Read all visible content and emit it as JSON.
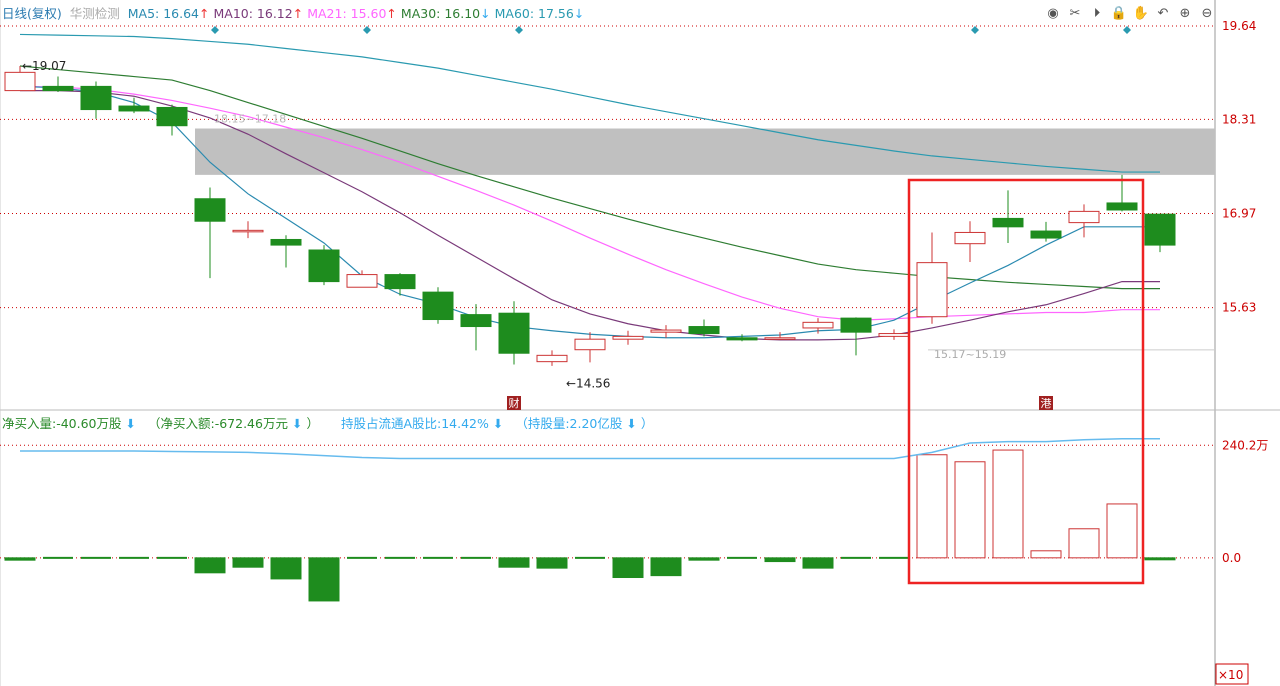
{
  "header": {
    "period": "日线(复权)",
    "name": "华测检测",
    "ma": [
      {
        "label": "MA5: ",
        "value": "16.64",
        "arrow": "↑",
        "color": "#2a8ab0"
      },
      {
        "label": "MA10: ",
        "value": "16.12",
        "arrow": "↑",
        "color": "#7a3a7a"
      },
      {
        "label": "MA21: ",
        "value": "15.60",
        "arrow": "↑",
        "color": "#ff66ff"
      },
      {
        "label": "MA30: ",
        "value": "16.10",
        "arrow": "↓",
        "color": "#2e7d32"
      },
      {
        "label": "MA60: ",
        "value": "17.56",
        "arrow": "↓",
        "color": "#2a9ab0"
      }
    ]
  },
  "toolbar": {
    "icons": [
      "eye-icon",
      "scissors-icon",
      "play-icon",
      "lock-icon",
      "hand-icon",
      "undo-icon",
      "zoom-in-icon",
      "zoom-out-icon"
    ],
    "glyphs": [
      "◉",
      "✂",
      "⏵",
      "🔒",
      "✋",
      "↶",
      "⊕",
      "⊖"
    ]
  },
  "indicator": {
    "net_buy": "净买入量:-40.60万股",
    "net_amount": "（净买入额:-672.46万元",
    "holding_ratio": "持股占流通A股比:14.42%",
    "holding_qty": "（持股量:2.20亿股",
    "arrow_down": "⬇",
    "close_paren": "）"
  },
  "markers": {
    "cai": "财",
    "gang": "港"
  },
  "colors": {
    "up": "#cc3333",
    "down": "#1e8c1e",
    "ma5": "#2a8ab0",
    "ma10": "#7a3a7a",
    "ma21": "#ff66ff",
    "ma30": "#2e7d32",
    "ma60": "#2a9ab0",
    "hold": "#66bbee",
    "grid": "#cc0000",
    "highlight": "#ee2222"
  },
  "chart_data": {
    "type": "candlestick",
    "y_ticks": [
      19.64,
      18.31,
      16.97,
      15.63
    ],
    "ylim": [
      14.2,
      19.64
    ],
    "annotations": {
      "high": "19.07",
      "low": "14.56",
      "gap_upper": "18.15~17.18",
      "gap_lower": "15.17~15.19"
    },
    "candles": [
      {
        "o": 18.72,
        "c": 18.98,
        "h": 19.07,
        "l": 18.72
      },
      {
        "o": 18.78,
        "c": 18.72,
        "h": 18.92,
        "l": 18.7
      },
      {
        "o": 18.78,
        "c": 18.45,
        "h": 18.85,
        "l": 18.32
      },
      {
        "o": 18.5,
        "c": 18.43,
        "h": 18.62,
        "l": 18.4
      },
      {
        "o": 18.48,
        "c": 18.22,
        "h": 18.52,
        "l": 18.08
      },
      {
        "o": 17.18,
        "c": 16.86,
        "h": 17.34,
        "l": 16.05
      },
      {
        "o": 16.73,
        "c": 16.73,
        "h": 16.86,
        "l": 16.62
      },
      {
        "o": 16.6,
        "c": 16.52,
        "h": 16.66,
        "l": 16.2
      },
      {
        "o": 16.45,
        "c": 16.0,
        "h": 16.52,
        "l": 15.95
      },
      {
        "o": 15.92,
        "c": 16.1,
        "h": 16.16,
        "l": 15.92
      },
      {
        "o": 16.1,
        "c": 15.9,
        "h": 16.12,
        "l": 15.8
      },
      {
        "o": 15.85,
        "c": 15.46,
        "h": 15.92,
        "l": 15.4
      },
      {
        "o": 15.53,
        "c": 15.36,
        "h": 15.68,
        "l": 15.02
      },
      {
        "o": 15.55,
        "c": 14.98,
        "h": 15.72,
        "l": 14.82
      },
      {
        "o": 14.86,
        "c": 14.95,
        "h": 15.02,
        "l": 14.8
      },
      {
        "o": 15.03,
        "c": 15.18,
        "h": 15.28,
        "l": 14.85
      },
      {
        "o": 15.18,
        "c": 15.22,
        "h": 15.3,
        "l": 15.1
      },
      {
        "o": 15.28,
        "c": 15.31,
        "h": 15.38,
        "l": 15.2
      },
      {
        "o": 15.36,
        "c": 15.26,
        "h": 15.46,
        "l": 15.22
      },
      {
        "o": 15.2,
        "c": 15.17,
        "h": 15.25,
        "l": 15.15
      },
      {
        "o": 15.18,
        "c": 15.2,
        "h": 15.28,
        "l": 15.17
      },
      {
        "o": 15.34,
        "c": 15.42,
        "h": 15.48,
        "l": 15.26
      },
      {
        "o": 15.48,
        "c": 15.28,
        "h": 15.49,
        "l": 14.95
      },
      {
        "o": 15.22,
        "c": 15.26,
        "h": 15.32,
        "l": 15.17
      },
      {
        "o": 15.5,
        "c": 16.27,
        "h": 16.7,
        "l": 15.4
      },
      {
        "o": 16.54,
        "c": 16.7,
        "h": 16.86,
        "l": 16.28
      },
      {
        "o": 16.9,
        "c": 16.78,
        "h": 17.3,
        "l": 16.55
      },
      {
        "o": 16.72,
        "c": 16.62,
        "h": 16.85,
        "l": 16.57
      },
      {
        "o": 16.84,
        "c": 17.0,
        "h": 17.1,
        "l": 16.63
      },
      {
        "o": 17.12,
        "c": 17.02,
        "h": 17.52,
        "l": 17.0
      },
      {
        "o": 16.96,
        "c": 16.52,
        "h": 16.96,
        "l": 16.42
      }
    ],
    "ma": {
      "ma5": [
        18.78,
        18.76,
        18.7,
        18.55,
        18.27,
        17.7,
        17.25,
        16.9,
        16.55,
        16.08,
        15.82,
        15.68,
        15.49,
        15.36,
        15.3,
        15.25,
        15.22,
        15.2,
        15.2,
        15.22,
        15.24,
        15.3,
        15.32,
        15.45,
        15.72,
        15.98,
        16.23,
        16.52,
        16.78,
        16.78
      ],
      "ma10": [
        18.72,
        18.72,
        18.7,
        18.64,
        18.5,
        18.33,
        18.1,
        17.82,
        17.55,
        17.28,
        16.98,
        16.66,
        16.35,
        16.04,
        15.74,
        15.54,
        15.4,
        15.3,
        15.24,
        15.19,
        15.17,
        15.17,
        15.18,
        15.24,
        15.34,
        15.45,
        15.57,
        15.67,
        15.83,
        16.0
      ],
      "ma21": [
        18.78,
        18.77,
        18.74,
        18.67,
        18.58,
        18.47,
        18.35,
        18.2,
        18.05,
        17.88,
        17.7,
        17.5,
        17.3,
        17.09,
        16.86,
        16.62,
        16.39,
        16.17,
        15.97,
        15.78,
        15.62,
        15.5,
        15.45,
        15.47,
        15.5,
        15.52,
        15.54,
        15.56,
        15.56,
        15.6
      ],
      "ma30": [
        19.07,
        19.02,
        18.97,
        18.92,
        18.87,
        18.72,
        18.55,
        18.38,
        18.21,
        18.04,
        17.86,
        17.68,
        17.51,
        17.35,
        17.19,
        17.04,
        16.89,
        16.75,
        16.62,
        16.49,
        16.37,
        16.25,
        16.17,
        16.12,
        16.07,
        16.03,
        15.99,
        15.96,
        15.93,
        15.9
      ],
      "ma60": [
        19.52,
        19.51,
        19.5,
        19.49,
        19.46,
        19.42,
        19.38,
        19.32,
        19.26,
        19.2,
        19.12,
        19.04,
        18.94,
        18.84,
        18.74,
        18.63,
        18.52,
        18.42,
        18.32,
        18.22,
        18.12,
        18.02,
        17.94,
        17.86,
        17.79,
        17.74,
        17.69,
        17.64,
        17.6,
        17.56
      ]
    },
    "ma_start_index": [
      0,
      0,
      0,
      0,
      0
    ],
    "gap_zone": {
      "from_index": 5,
      "lo": 17.52,
      "hi": 18.18
    },
    "sub": {
      "y_ticks": [
        "240.2万",
        "0.0"
      ],
      "ylim": [
        -90,
        260
      ],
      "scale_label": "×10",
      "net_buy": [
        -5,
        0,
        0,
        0,
        0,
        -32,
        -20,
        -45,
        -92,
        0,
        0,
        0,
        0,
        -20,
        -22,
        0,
        -42,
        -38,
        -5,
        0,
        -8,
        -22,
        0,
        0,
        220,
        205,
        230,
        15,
        62,
        115,
        -3
      ],
      "holding": [
        228,
        228,
        228,
        228,
        227,
        226,
        225,
        222,
        218,
        214,
        212,
        212,
        212,
        212,
        212,
        212,
        212,
        212,
        212,
        212,
        212,
        212,
        212,
        212,
        225,
        245,
        248,
        248,
        252,
        254,
        254
      ]
    }
  }
}
